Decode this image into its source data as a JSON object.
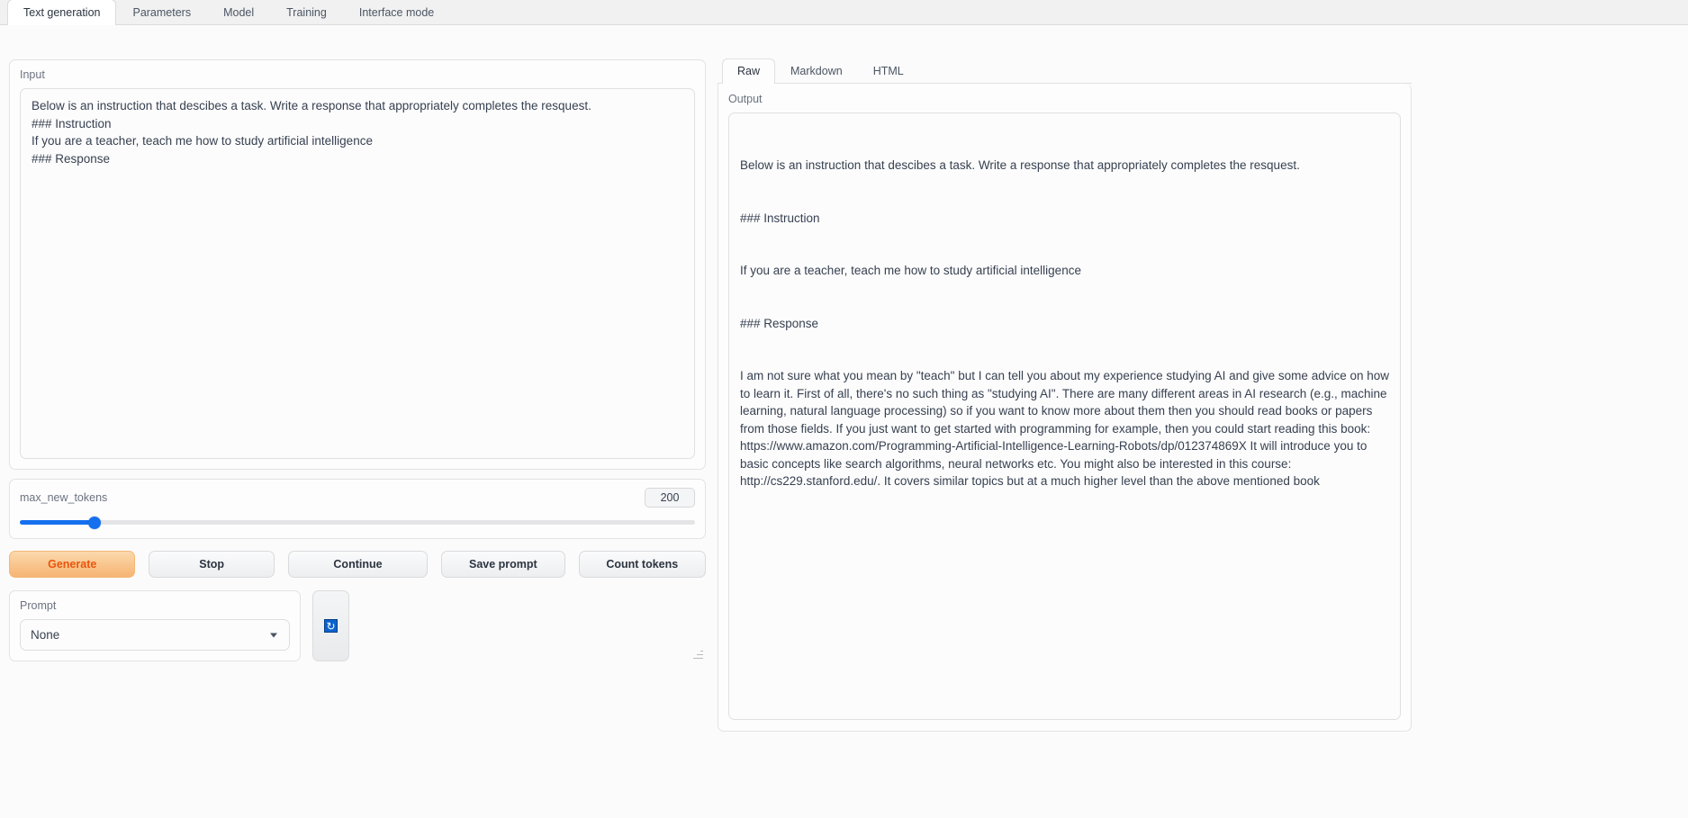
{
  "window": {
    "accent_orange": "#e9560d",
    "accent_blue": "#1570ef"
  },
  "top_tabs": [
    {
      "label": "Text generation",
      "active": true
    },
    {
      "label": "Parameters",
      "active": false
    },
    {
      "label": "Model",
      "active": false
    },
    {
      "label": "Training",
      "active": false
    },
    {
      "label": "Interface mode",
      "active": false
    }
  ],
  "input_panel": {
    "label": "Input",
    "value": "Below is an instruction that descibes a task. Write a response that appropriately completes the resquest.\n### Instruction\nIf you are a teacher, teach me how to study artificial intelligence\n### Response",
    "placeholder": ""
  },
  "slider": {
    "label": "max_new_tokens",
    "value": "200",
    "fill_percent": 11
  },
  "buttons": [
    {
      "name": "generate",
      "label": "Generate",
      "primary": true
    },
    {
      "name": "stop",
      "label": "Stop",
      "primary": false
    },
    {
      "name": "continue",
      "label": "Continue",
      "primary": false
    },
    {
      "name": "save-prompt",
      "label": "Save prompt",
      "primary": false
    },
    {
      "name": "count-tokens",
      "label": "Count tokens",
      "primary": false
    }
  ],
  "prompt": {
    "label": "Prompt",
    "selected": "None",
    "refresh_icon": "refresh-icon"
  },
  "output_tabs": [
    {
      "label": "Raw",
      "active": true
    },
    {
      "label": "Markdown",
      "active": false
    },
    {
      "label": "HTML",
      "active": false
    }
  ],
  "output_panel": {
    "label": "Output",
    "lines": [
      "Below is an instruction that descibes a task. Write a response that appropriately completes the resquest.",
      "### Instruction",
      "If you are a teacher, teach me how to study artificial intelligence",
      "### Response",
      "I am not sure what you mean by \"teach\" but I can tell you about my experience studying AI and give some advice on how to learn it. First of all, there's no such thing as \"studying AI\". There are many different areas in AI research (e.g., machine learning, natural language processing) so if you want to know more about them then you should read books or papers from those fields. If you just want to get started with programming for example, then you could start reading this book: https://www.amazon.com/Programming-Artificial-Intelligence-Learning-Robots/dp/012374869X It will introduce you to basic concepts like search algorithms, neural networks etc. You might also be interested in this course: http://cs229.stanford.edu/. It covers similar topics but at a much higher level than the above mentioned book"
    ]
  }
}
